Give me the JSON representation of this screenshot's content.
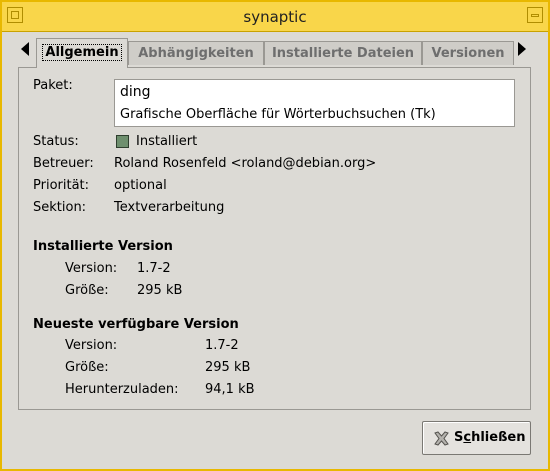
{
  "window": {
    "title": "synaptic"
  },
  "tabs": [
    {
      "label": "Allgemein",
      "active": true
    },
    {
      "label": "Abhängigkeiten",
      "active": false
    },
    {
      "label": "Installierte Dateien",
      "active": false
    },
    {
      "label": "Versionen",
      "active": false
    }
  ],
  "general": {
    "package_label": "Paket:",
    "package_name": "ding",
    "package_description": "Grafische Oberfläche für Wörterbuchsuchen (Tk)",
    "status_label": "Status:",
    "status_value": "Installiert",
    "status_color": "#6e8f6e",
    "maintainer_label": "Betreuer:",
    "maintainer_value": "Roland Rosenfeld <roland@debian.org>",
    "priority_label": "Priorität:",
    "priority_value": "optional",
    "section_label": "Sektion:",
    "section_value": "Textverarbeitung"
  },
  "installed_version": {
    "heading": "Installierte Version",
    "version_label": "Version:",
    "version_value": "1.7-2",
    "size_label": "Größe:",
    "size_value": "295 kB"
  },
  "latest_version": {
    "heading": "Neueste verfügbare Version",
    "version_label": "Version:",
    "version_value": "1.7-2",
    "size_label": "Größe:",
    "size_value": "295 kB",
    "download_label": "Herunterzuladen:",
    "download_value": "94,1 kB"
  },
  "buttons": {
    "close_prefix": "S",
    "close_mnemonic": "c",
    "close_suffix": "hließen",
    "close_icon": "close-icon"
  }
}
